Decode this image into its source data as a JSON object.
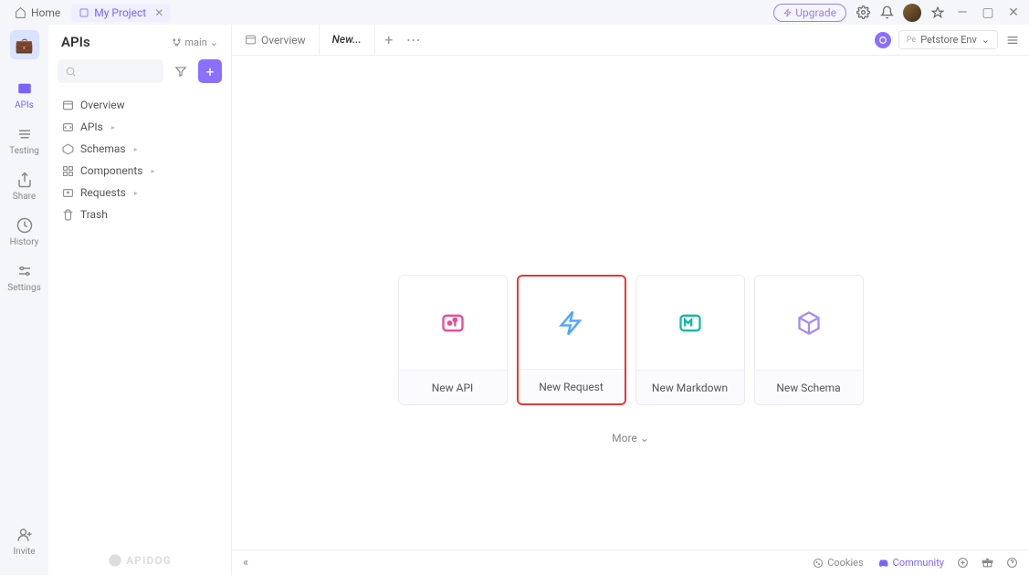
{
  "titlebar": {
    "home": "Home",
    "project": "My Project",
    "upgrade": "Upgrade"
  },
  "rail": {
    "items": [
      {
        "label": "APIs"
      },
      {
        "label": "Testing"
      },
      {
        "label": "Share"
      },
      {
        "label": "History"
      },
      {
        "label": "Settings"
      }
    ],
    "invite": "Invite"
  },
  "sidebar": {
    "title": "APIs",
    "branch": "main",
    "tree": [
      {
        "label": "Overview"
      },
      {
        "label": "APIs"
      },
      {
        "label": "Schemas"
      },
      {
        "label": "Components"
      },
      {
        "label": "Requests"
      },
      {
        "label": "Trash"
      }
    ],
    "brand": "APIDOG"
  },
  "tabs": {
    "overview": "Overview",
    "new": "New...",
    "env_badge": "Pe",
    "env": "Petstore Env"
  },
  "cards": [
    {
      "label": "New API"
    },
    {
      "label": "New Request"
    },
    {
      "label": "New Markdown"
    },
    {
      "label": "New Schema"
    }
  ],
  "more": "More",
  "statusbar": {
    "cookies": "Cookies",
    "community": "Community"
  }
}
